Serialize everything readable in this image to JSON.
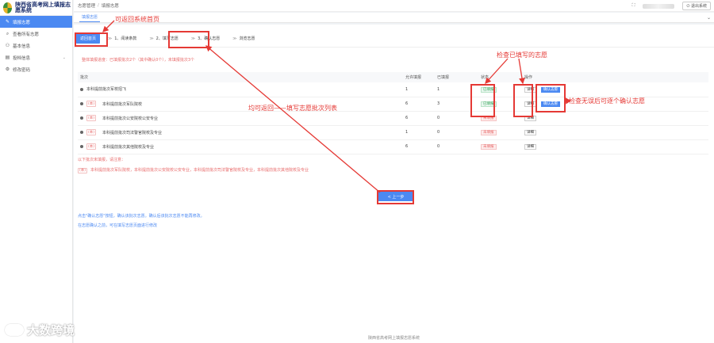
{
  "sidebar": {
    "title": "陕西省高考网上填报志愿系统",
    "items": [
      {
        "label": "填报志愿",
        "icon": "edit-icon"
      },
      {
        "label": "查看所有志愿",
        "icon": "search-icon"
      },
      {
        "label": "基本信息",
        "icon": "user-icon"
      },
      {
        "label": "投档信息",
        "icon": "document-icon"
      },
      {
        "label": "修改密码",
        "icon": "settings-icon"
      }
    ]
  },
  "topbar": {
    "breadcrumb_1": "志愿管理",
    "breadcrumb_sep": "/",
    "breadcrumb_2": "填报志愿",
    "exit_label": "退出系统"
  },
  "tabs": {
    "active": "填报志愿"
  },
  "steps": {
    "home_btn": "返回首页",
    "items": [
      "1、阅读条款",
      "2、填写志愿",
      "3、确认志愿",
      "浏览志愿"
    ]
  },
  "summary": "整体填报进度：已填报批次2个（其中确认0个），未填报批次3个",
  "table": {
    "headers": [
      "批次",
      "允许填报",
      "已填报",
      "状态",
      "操作"
    ],
    "rows": [
      {
        "tag": "",
        "name": "本科提前批次军校招飞",
        "allowed": "1",
        "filled": "1",
        "status": "已填报",
        "action": "详细",
        "confirm": "确认志愿"
      },
      {
        "tag": "(本)",
        "name": "本科提前批次军队院校",
        "allowed": "6",
        "filled": "3",
        "status": "已填报",
        "action": "详细",
        "confirm": "确认志愿"
      },
      {
        "tag": "(本)",
        "name": "本科提前批次公安院校公安专业",
        "allowed": "6",
        "filled": "0",
        "status": "未填报",
        "action": "详细",
        "confirm": ""
      },
      {
        "tag": "(本)",
        "name": "本科提前批次司法警官院校及专业",
        "allowed": "1",
        "filled": "0",
        "status": "未填报",
        "action": "详细",
        "confirm": ""
      },
      {
        "tag": "(本)",
        "name": "本科提前批次其他院校及专业",
        "allowed": "6",
        "filled": "0",
        "status": "未填报",
        "action": "详细",
        "confirm": ""
      }
    ]
  },
  "notice": {
    "line1": "以下批次未填报，请注意：",
    "tag": "(本)",
    "line2": "本科提前批次军队院校，本科提前批次公安院校公安专业，本科提前批次司法警官院校及专业，本科提前批次其他院校及专业"
  },
  "prev_btn": "< 上一步",
  "notes": {
    "line1": "点击\"确认志愿\"按钮，确认该批次志愿。确认后该批次志愿不能再修改。",
    "line2": "在志愿确认之前，可在填写志愿页面进行修改"
  },
  "footer": "陕西省高考网上填报志愿系统",
  "annotations": {
    "home": "可返回系统首页",
    "check": "检查已填写的志愿",
    "confirm": "检查无误后可逐个确认志愿",
    "back": "均可返回——填写志愿批次列表"
  },
  "watermark": "大数跨境",
  "colors": {
    "accent": "#4b89f2",
    "annotation": "#e53935"
  }
}
